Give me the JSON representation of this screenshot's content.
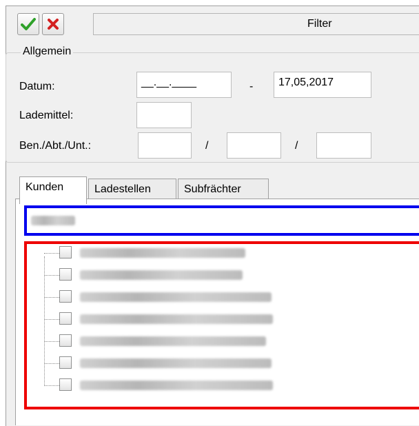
{
  "toolbar": {
    "title": "Filter",
    "ok_icon": "checkmark-icon",
    "cancel_icon": "close-icon",
    "colors": {
      "ok": "#2fa12a",
      "cancel": "#d32020"
    }
  },
  "general": {
    "legend": "Allgemein",
    "date_label": "Datum:",
    "date_from": "__.__.____",
    "date_sep": "-",
    "date_to": "17,05,2017",
    "lademittel_label": "Lademittel:",
    "lademittel_value": "",
    "ben_label": "Ben./Abt./Unt.:",
    "ben_sep1": "/",
    "ben_sep2": "/"
  },
  "tabs": [
    {
      "label": "Kunden",
      "active": true
    },
    {
      "label": "Ladestellen",
      "active": false
    },
    {
      "label": "Subfrächter",
      "active": false
    }
  ],
  "highlight_colors": {
    "search": "#0000ee",
    "list": "#ee0000"
  },
  "tree_items_count_visible": 7
}
